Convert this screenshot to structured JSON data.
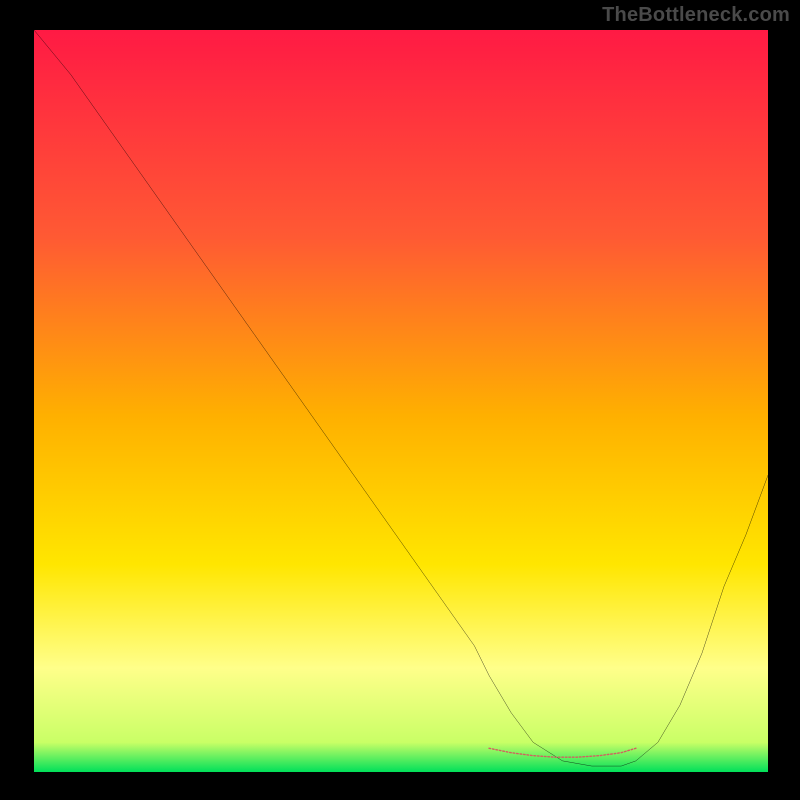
{
  "watermark": "TheBottleneck.com",
  "chart_data": {
    "type": "line",
    "title": "",
    "xlabel": "",
    "ylabel": "",
    "xlim": [
      0,
      100
    ],
    "ylim": [
      0,
      100
    ],
    "grid": false,
    "legend": false,
    "background_gradient": {
      "top": "#ff1a44",
      "mid1": "#ff7a33",
      "mid2": "#ffd400",
      "mid3": "#ffff66",
      "bottom": "#00e05a"
    },
    "series": [
      {
        "name": "bottleneck-curve",
        "color": "#000000",
        "x": [
          0,
          5,
          10,
          15,
          20,
          25,
          30,
          35,
          40,
          45,
          50,
          55,
          60,
          62,
          65,
          68,
          72,
          76,
          80,
          82,
          85,
          88,
          91,
          94,
          97,
          100
        ],
        "y": [
          100,
          94,
          87,
          80,
          73,
          66,
          59,
          52,
          45,
          38,
          31,
          24,
          17,
          13,
          8,
          4,
          1.5,
          0.8,
          0.8,
          1.5,
          4,
          9,
          16,
          25,
          32,
          40
        ]
      }
    ],
    "marker_band": {
      "name": "optimal-range",
      "color": "#d1625f",
      "x": [
        62,
        65,
        68,
        71,
        74,
        77,
        80,
        82
      ],
      "y": [
        3.2,
        2.6,
        2.2,
        2.0,
        2.0,
        2.2,
        2.6,
        3.2
      ]
    }
  }
}
